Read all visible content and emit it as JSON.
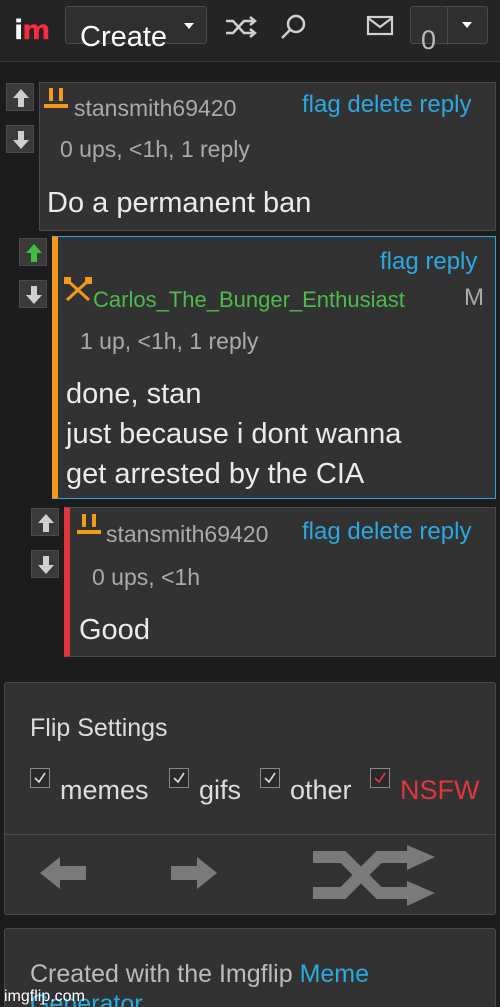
{
  "topbar": {
    "logo_i": "i",
    "logo_m": "m",
    "create_label": "Create",
    "notification_count": "0",
    "icons": [
      "shuffle-icon",
      "search-icon",
      "mail-icon",
      "chevron-down-icon"
    ]
  },
  "comments": [
    {
      "user": "stansmith69420",
      "actions": "flag delete reply",
      "meta": "0 ups, <1h, 1 reply",
      "lines": [
        "Do a permanent ban"
      ],
      "badge": "mod-badge",
      "upvoted": false
    },
    {
      "user": "Carlos_The_Bunger_Enthusiast",
      "user_suffix": "M",
      "actions": "flag reply",
      "meta": "1 up, <1h, 1 reply",
      "lines": [
        "done, stan",
        "just because i dont wanna",
        "get arrested by the CIA"
      ],
      "badge": "crossed-swords-badge",
      "upvoted": true,
      "accent_color": "#f39a1e"
    },
    {
      "user": "stansmith69420",
      "actions": "flag delete reply",
      "meta": "0 ups, <1h",
      "lines": [
        "Good"
      ],
      "badge": "mod-badge",
      "upvoted": false,
      "accent_color": "#e0373f"
    }
  ],
  "flip_settings": {
    "title": "Flip Settings",
    "options": [
      {
        "label": "memes",
        "checked": true
      },
      {
        "label": "gifs",
        "checked": true
      },
      {
        "label": "other",
        "checked": true
      },
      {
        "label": "NSFW",
        "checked": true
      }
    ]
  },
  "footer": {
    "text": "Created with the Imgflip ",
    "link": "Meme",
    "link2": "Generator",
    "watermark": "imgflip.com"
  },
  "colors": {
    "background": "#1c1c1c",
    "panel": "#323232",
    "link": "#2aa9e0",
    "upvote_green": "#3fbf3f",
    "nsfw_red": "#e0373f",
    "username_green": "#4dbb4d"
  }
}
